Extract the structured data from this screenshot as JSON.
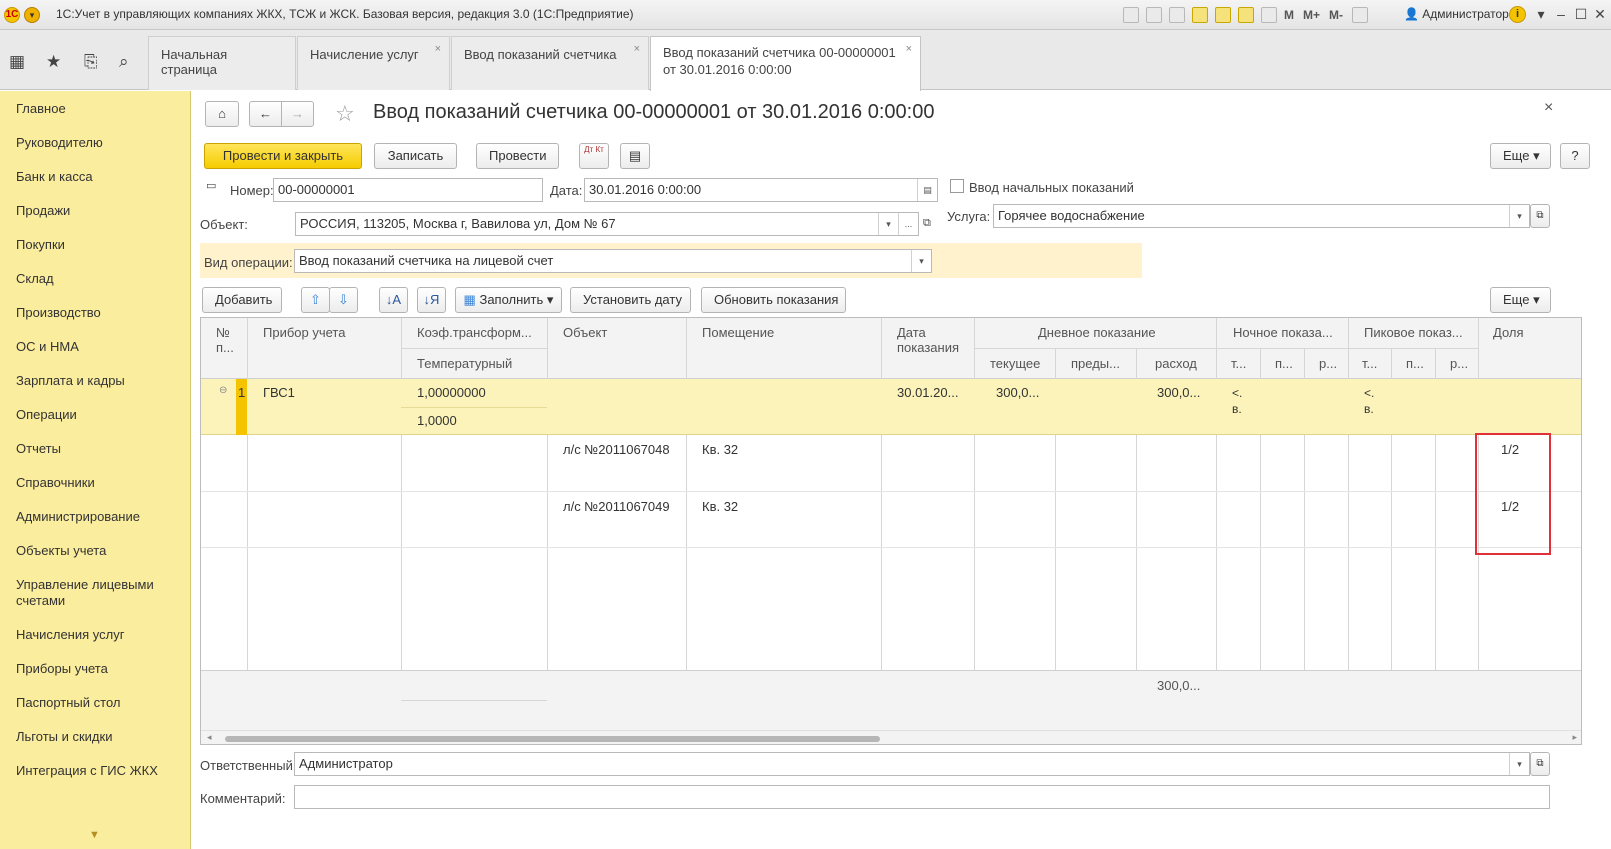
{
  "window": {
    "title": "1С:Учет в управляющих компаниях ЖКХ, ТСЖ и ЖСК. Базовая версия, редакция 3.0  (1С:Предприятие)",
    "mem_labels": [
      "M",
      "M+",
      "M-"
    ],
    "user": "Администратор",
    "info": "i"
  },
  "tabs": [
    {
      "label": "Начальная страница",
      "line2": ""
    },
    {
      "label": "Начисление услуг",
      "line2": ""
    },
    {
      "label": "Ввод показаний счетчика",
      "line2": ""
    },
    {
      "label": "Ввод показаний счетчика 00-00000001",
      "line2": "от 30.01.2016 0:00:00"
    }
  ],
  "sidebar": {
    "items": [
      "Главное",
      "Руководителю",
      "Банк и касса",
      "Продажи",
      "Покупки",
      "Склад",
      "Производство",
      "ОС и НМА",
      "Зарплата и кадры",
      "Операции",
      "Отчеты",
      "Справочники",
      "Администрирование",
      "Объекты учета",
      "Управление лицевыми счетами",
      "Начисления услуг",
      "Приборы учета",
      "Паспортный стол",
      "Льготы и скидки",
      "Интеграция с ГИС ЖКХ"
    ]
  },
  "document": {
    "title": "Ввод показаний счетчика 00-00000001 от 30.01.2016 0:00:00",
    "buttons": {
      "post_close": "Провести и закрыть",
      "save": "Записать",
      "post": "Провести",
      "dtkt": "Дт Кт",
      "more": "Еще",
      "help": "?"
    },
    "number_label": "Номер:",
    "number": "00-00000001",
    "date_label": "Дата:",
    "date": "30.01.2016  0:00:00",
    "initial_readings_label": "Ввод начальных показаний",
    "object_label": "Объект:",
    "object": "РОССИЯ, 113205, Москва г, Вавилова ул, Дом № 67",
    "service_label": "Услуга:",
    "service": "Горячее водоснабжение",
    "operation_label": "Вид операции:",
    "operation": "Ввод показаний счетчика на лицевой счет",
    "table_buttons": {
      "add": "Добавить",
      "fill": "Заполнить",
      "set_date": "Установить дату",
      "update": "Обновить показания",
      "more": "Еще"
    },
    "columns": {
      "num": "№ п...",
      "device": "Прибор учета",
      "coef": "Коэф.трансформ...",
      "temp": "Температурный",
      "object": "Объект",
      "room": "Помещение",
      "date": "Дата показания",
      "day": "Дневное показание",
      "day_cur": "текущее",
      "day_prev": "преды...",
      "day_cons": "расход",
      "night": "Ночное показа...",
      "night_sub": [
        "т...",
        "п...",
        "р..."
      ],
      "peak": "Пиковое показ...",
      "peak_sub": [
        "т...",
        "п...",
        "р..."
      ],
      "share": "Доля"
    },
    "rows": [
      {
        "num": "1",
        "device": "ГВС1",
        "coef": "1,00000000",
        "temp": "1,0000",
        "date": "30.01.20...",
        "day_cur": "300,0...",
        "day_cons": "300,0...",
        "night": "<.\nв.",
        "peak": "<.\nв."
      }
    ],
    "sub_rows": [
      {
        "account": "л/с №2011067048",
        "room": "Кв. 32",
        "share": "1/2"
      },
      {
        "account": "л/с №2011067049",
        "room": "Кв. 32",
        "share": "1/2"
      }
    ],
    "total_consumption": "300,0...",
    "responsible_label": "Ответственный:",
    "responsible": "Администратор",
    "comment_label": "Комментарий:",
    "comment": ""
  }
}
